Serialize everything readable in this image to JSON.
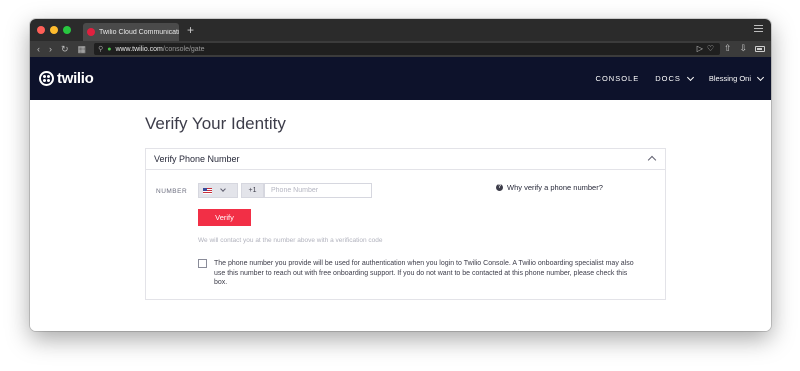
{
  "browser": {
    "tab_title": "Twilio Cloud Communicatio",
    "new_tab": "+",
    "url_domain": "www.twilio.com",
    "url_path": "/console/gate",
    "traffic_lights": [
      "#ff5f57",
      "#febc2e",
      "#28c840"
    ]
  },
  "header": {
    "logo_text": "twilio",
    "nav": {
      "console": "CONSOLE",
      "docs": "DOCS",
      "user": "Blessing Oni"
    }
  },
  "page": {
    "title": "Verify Your Identity"
  },
  "card": {
    "title": "Verify Phone Number",
    "number_label": "NUMBER",
    "dial_code": "+1",
    "phone_placeholder": "Phone Number",
    "phone_value": "",
    "why_link": "Why verify a phone number?",
    "verify_button": "Verify",
    "helper_text": "We will contact you at the number above with a verification code",
    "consent_text": "The phone number you provide will be used for authentication when you login to Twilio Console. A Twilio onboarding specialist may also use this number to reach out with free onboarding support. If you do not want to be contacted at this phone number, please check this box.",
    "consent_checked": false
  },
  "colors": {
    "brand_navy": "#0d122b",
    "brand_red": "#f22f46"
  }
}
